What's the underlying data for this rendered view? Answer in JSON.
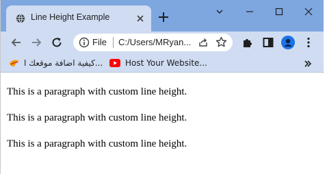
{
  "tab": {
    "title": "Line Height Example"
  },
  "omnibox": {
    "scheme_label": "File",
    "url": "C:/Users/MRyan..."
  },
  "bookmarks": [
    {
      "label": "كيفية اضافة موقعك ا..."
    },
    {
      "label": "Host Your Website..."
    }
  ],
  "page": {
    "paragraphs": [
      "This is a paragraph with custom line height.",
      "This is a paragraph with custom line height.",
      "This is a paragraph with custom line height."
    ]
  },
  "colors": {
    "tabstrip": "#7ea7e0",
    "toolbar": "#cfdcf2",
    "profile": "#1a73e8",
    "youtube": "#ff0000"
  }
}
